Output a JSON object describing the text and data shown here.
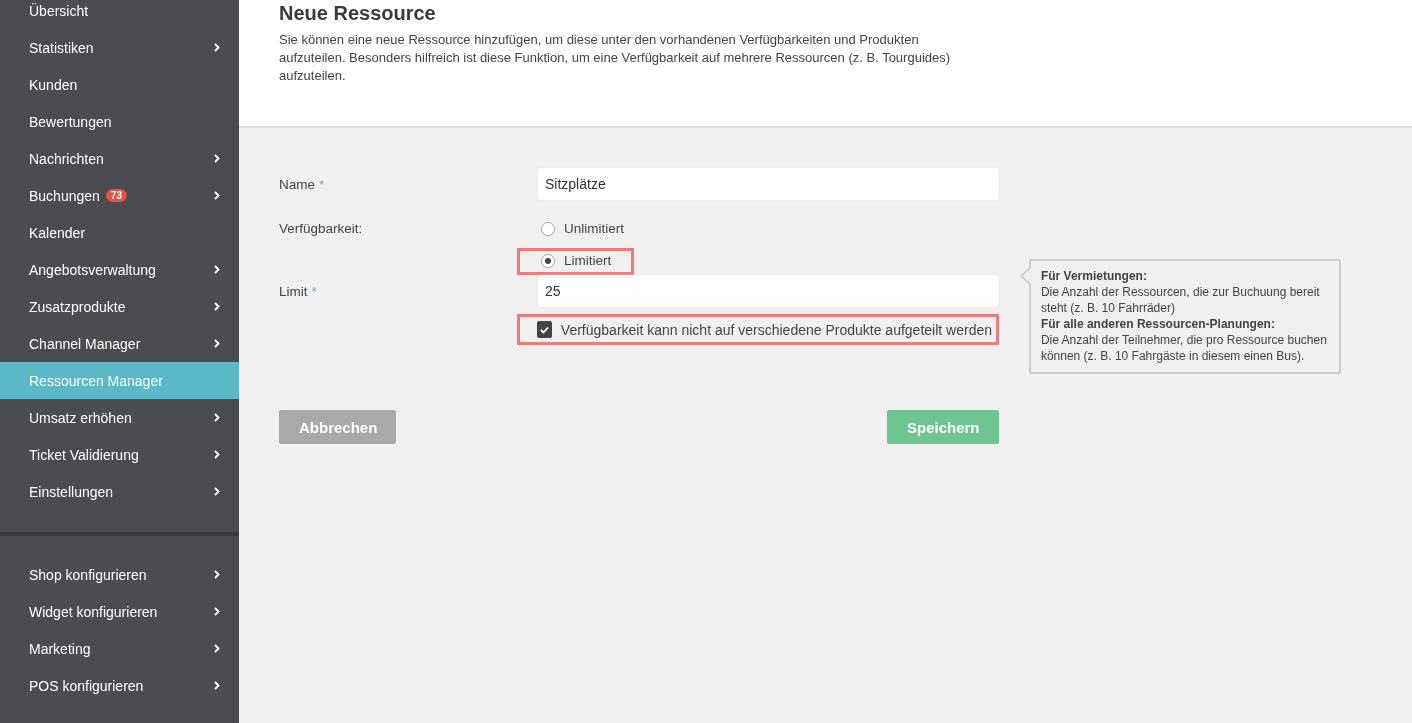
{
  "sidebar": {
    "groups": [
      {
        "items": [
          {
            "label": "Übersicht",
            "chevron": false,
            "selected": false
          },
          {
            "label": "Statistiken",
            "chevron": true,
            "selected": false
          },
          {
            "label": "Kunden",
            "chevron": false,
            "selected": false
          },
          {
            "label": "Bewertungen",
            "chevron": false,
            "selected": false
          },
          {
            "label": "Nachrichten",
            "chevron": true,
            "selected": false
          },
          {
            "label": "Buchungen",
            "badge": "73",
            "chevron": true,
            "selected": false
          },
          {
            "label": "Kalender",
            "chevron": false,
            "selected": false
          },
          {
            "label": "Angebotsverwaltung",
            "chevron": true,
            "selected": false
          },
          {
            "label": "Zusatzprodukte",
            "chevron": true,
            "selected": false
          },
          {
            "label": "Channel Manager",
            "chevron": true,
            "selected": false
          },
          {
            "label": "Ressourcen Manager",
            "chevron": false,
            "selected": true
          },
          {
            "label": "Umsatz erhöhen",
            "chevron": true,
            "selected": false
          },
          {
            "label": "Ticket Validierung",
            "chevron": true,
            "selected": false
          },
          {
            "label": "Einstellungen",
            "chevron": true,
            "selected": false
          }
        ]
      },
      {
        "items": [
          {
            "label": "Shop konfigurieren",
            "chevron": true,
            "selected": false
          },
          {
            "label": "Widget konfigurieren",
            "chevron": true,
            "selected": false
          },
          {
            "label": "Marketing",
            "chevron": true,
            "selected": false
          },
          {
            "label": "POS konfigurieren",
            "chevron": true,
            "selected": false
          }
        ]
      }
    ]
  },
  "header": {
    "title": "Neue Ressource",
    "description": "Sie können eine neue Ressource hinzufügen, um diese unter den vorhandenen Verfügbarkeiten und Produkten aufzuteilen. Besonders hilfreich ist diese Funktion, um eine Verfügbarkeit auf mehrere Ressourcen (z. B. Tourguides) aufzuteilen."
  },
  "form": {
    "name": {
      "label": "Name",
      "required_mark": "*",
      "value": "Sitzplätze"
    },
    "availability": {
      "label": "Verfügbarkeit:",
      "options": [
        {
          "label": "Unlimitiert",
          "selected": false,
          "highlighted": false
        },
        {
          "label": "Limitiert",
          "selected": true,
          "highlighted": true
        }
      ]
    },
    "limit": {
      "label": "Limit",
      "required_mark": "*",
      "value": "25"
    },
    "split_checkbox": {
      "label": "Verfügbarkeit kann nicht auf verschiedene Produkte aufgeteilt werden",
      "checked": true,
      "highlighted": true
    },
    "tooltip": {
      "heading_1": "Für Vermietungen:",
      "text_1": "Die Anzahl der Ressourcen, die zur Buchuung bereit steht (z. B. 10 Fahrräder)",
      "heading_2": "Für alle anderen Ressourcen-Planungen:",
      "text_2": "Die Anzahl der Teilnehmer, die pro Ressource buchen können (z. B. 10 Fahrgäste in diesem einen Bus)."
    },
    "cancel_button": "Abbrechen",
    "save_button": "Speichern"
  }
}
